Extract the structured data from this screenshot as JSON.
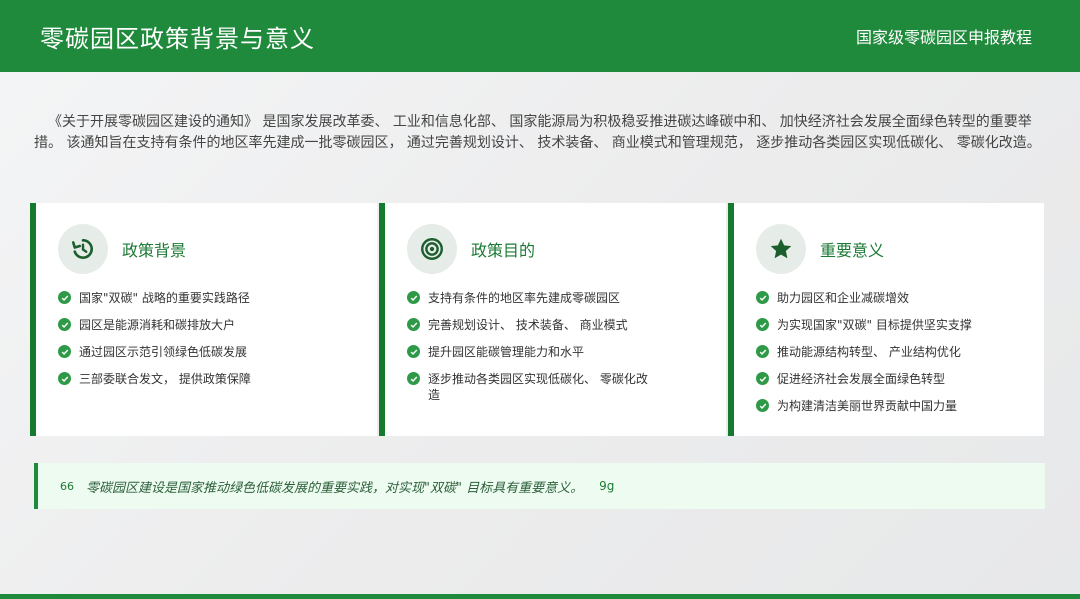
{
  "header": {
    "title": "零碳园区政策背景与意义",
    "subtitle": "国家级零碳园区申报教程"
  },
  "intro": "《关于开展零碳园区建设的通知》 是国家发展改革委、 工业和信息化部、 国家能源局为积极稳妥推进碳达峰碳中和、 加快经济社会发展全面绿色转型的重要举措。 该通知旨在支持有条件的地区率先建成一批零碳园区， 通过完善规划设计、 技术装备、 商业模式和管理规范， 逐步推动各类园区实现低碳化、 零碳化改造。",
  "cards": [
    {
      "icon": "history-icon",
      "title": "政策背景",
      "items": [
        "国家\"双碳\" 战略的重要实践路径",
        "园区是能源消耗和碳排放大户",
        "通过园区示范引领绿色低碳发展",
        "三部委联合发文， 提供政策保障"
      ]
    },
    {
      "icon": "target-icon",
      "title": "政策目的",
      "items": [
        "支持有条件的地区率先建成零碳园区",
        "完善规划设计、 技术装备、 商业模式",
        "提升园区能碳管理能力和水平",
        "逐步推动各类园区实现低碳化、 零碳化改造"
      ]
    },
    {
      "icon": "star-icon",
      "title": "重要意义",
      "items": [
        "助力园区和企业减碳增效",
        "为实现国家\"双碳\" 目标提供坚实支撑",
        "推动能源结构转型、 产业结构优化",
        "促进经济社会发展全面绿色转型",
        "为构建清洁美丽世界贡献中国力量"
      ]
    }
  ],
  "quote": {
    "mark": "66",
    "text": "零碳园区建设是国家推动绿色低碳发展的重要实践，对实现\"双碳\" 目标具有重要意义。",
    "tail": "9g"
  },
  "colors": {
    "brand_green": "#1f8a3c",
    "card_border": "#157a2e",
    "quote_bg": "#eefbf0"
  }
}
